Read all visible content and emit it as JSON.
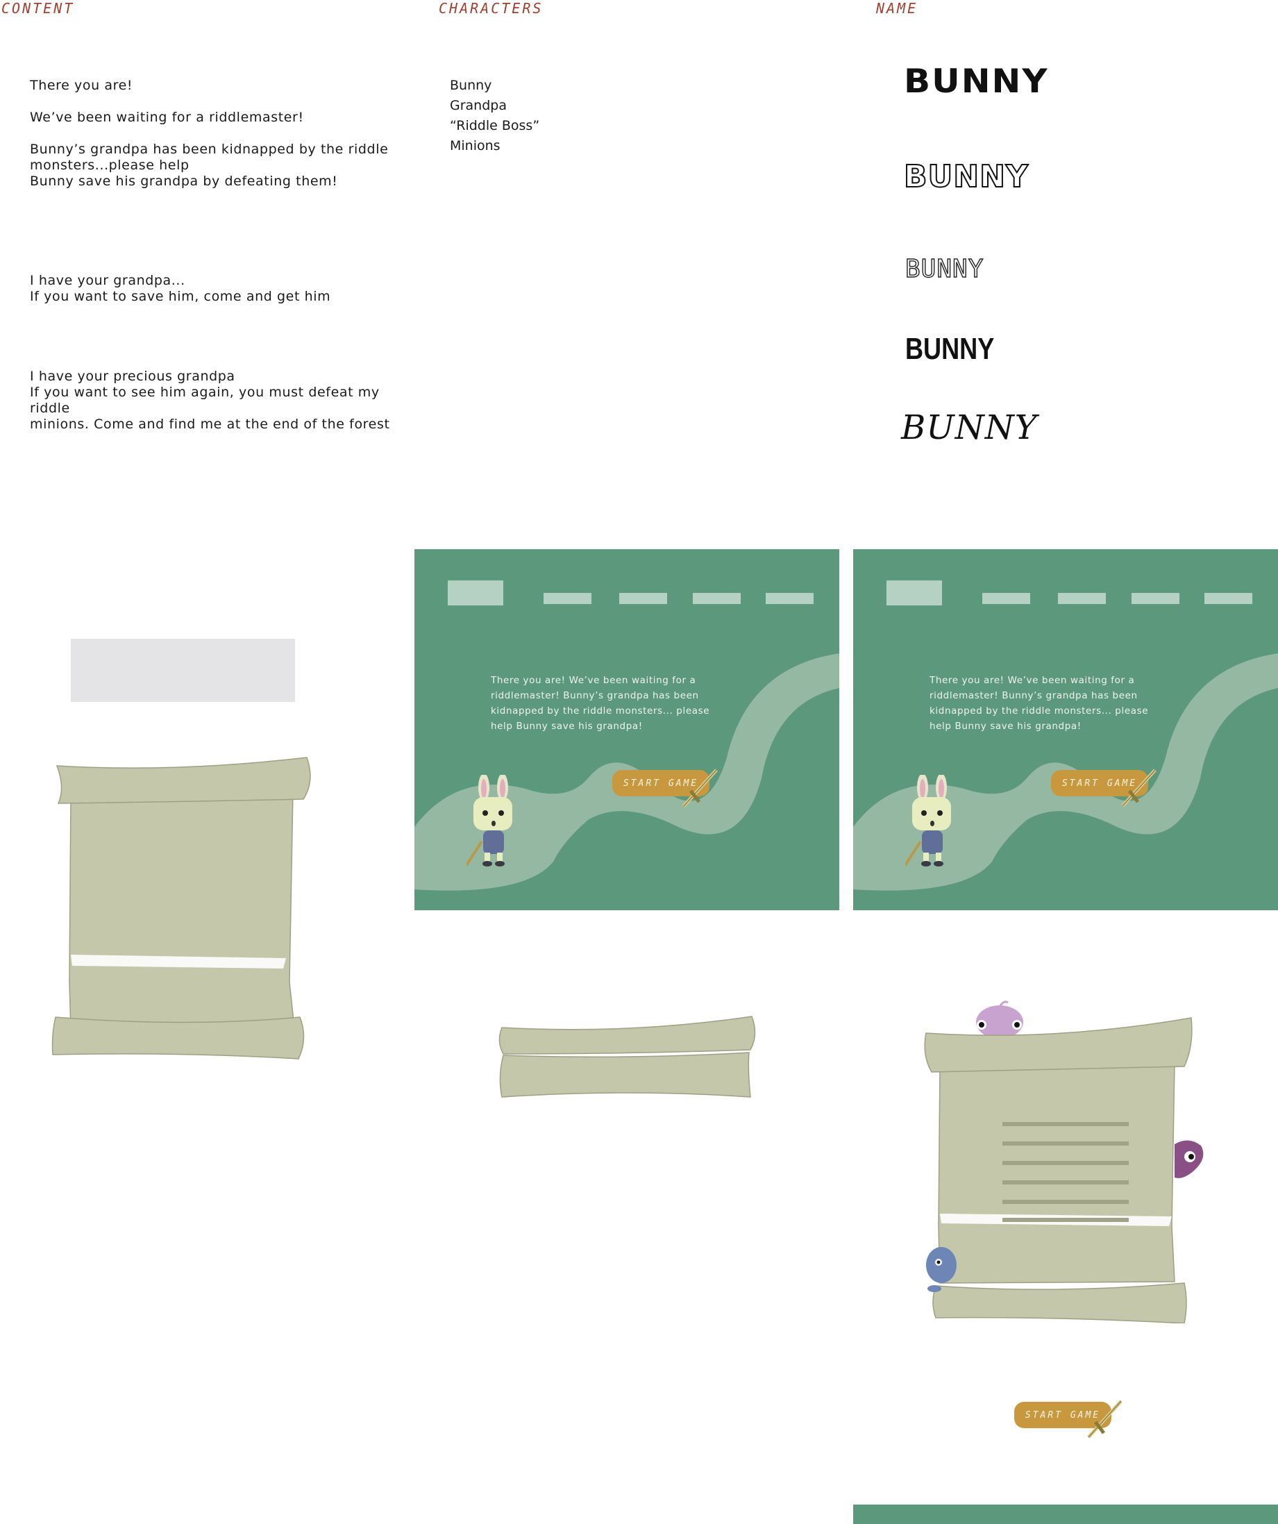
{
  "headers": {
    "content": "CONTENT",
    "characters": "CHARACTERS",
    "name": "NAME"
  },
  "content_blocks": [
    "There you are!\n\nWe’ve been waiting for a riddlemaster!\n\nBunny’s grandpa has been kidnapped by the riddle\nmonsters...please help\nBunny save his grandpa by defeating them!",
    "I have your grandpa...\nIf you want to save him, come and get him",
    "I have your precious grandpa\nIf you want to see him again, you must defeat my riddle\nminions. Come and find me at the end of the forest"
  ],
  "characters": [
    "Bunny",
    "Grandpa",
    "“Riddle Boss”",
    "Minions"
  ],
  "name_samples": [
    "BUNNY",
    "BUNNY",
    "BUNNY",
    "BUNNY",
    "BUNNY"
  ],
  "screens": [
    {
      "intro": "There you are! We’ve been waiting for a riddlemaster! Bunny’s grandpa has been kidnapped by the riddle monsters... please help Bunny save his grandpa!",
      "button": "START GAME"
    },
    {
      "intro": "There you are! We’ve been waiting for a riddlemaster! Bunny’s grandpa has been kidnapped by the riddle monsters... please help Bunny save his grandpa!",
      "button": "START GAME"
    }
  ],
  "standalone_button": "START GAME",
  "icons": {
    "bunny": "bunny-character-icon",
    "sword": "sword-icon",
    "scroll": "scroll-icon",
    "monster_pink": "pink-monster-icon",
    "monster_purple": "purple-monster-icon",
    "monster_blue": "blue-monster-icon"
  },
  "colors": {
    "accent_header": "#a0402f",
    "screen_bg": "#5c987b",
    "path": "#95b8a2",
    "button": "#c7983e",
    "scroll": "#c4c7aa"
  }
}
